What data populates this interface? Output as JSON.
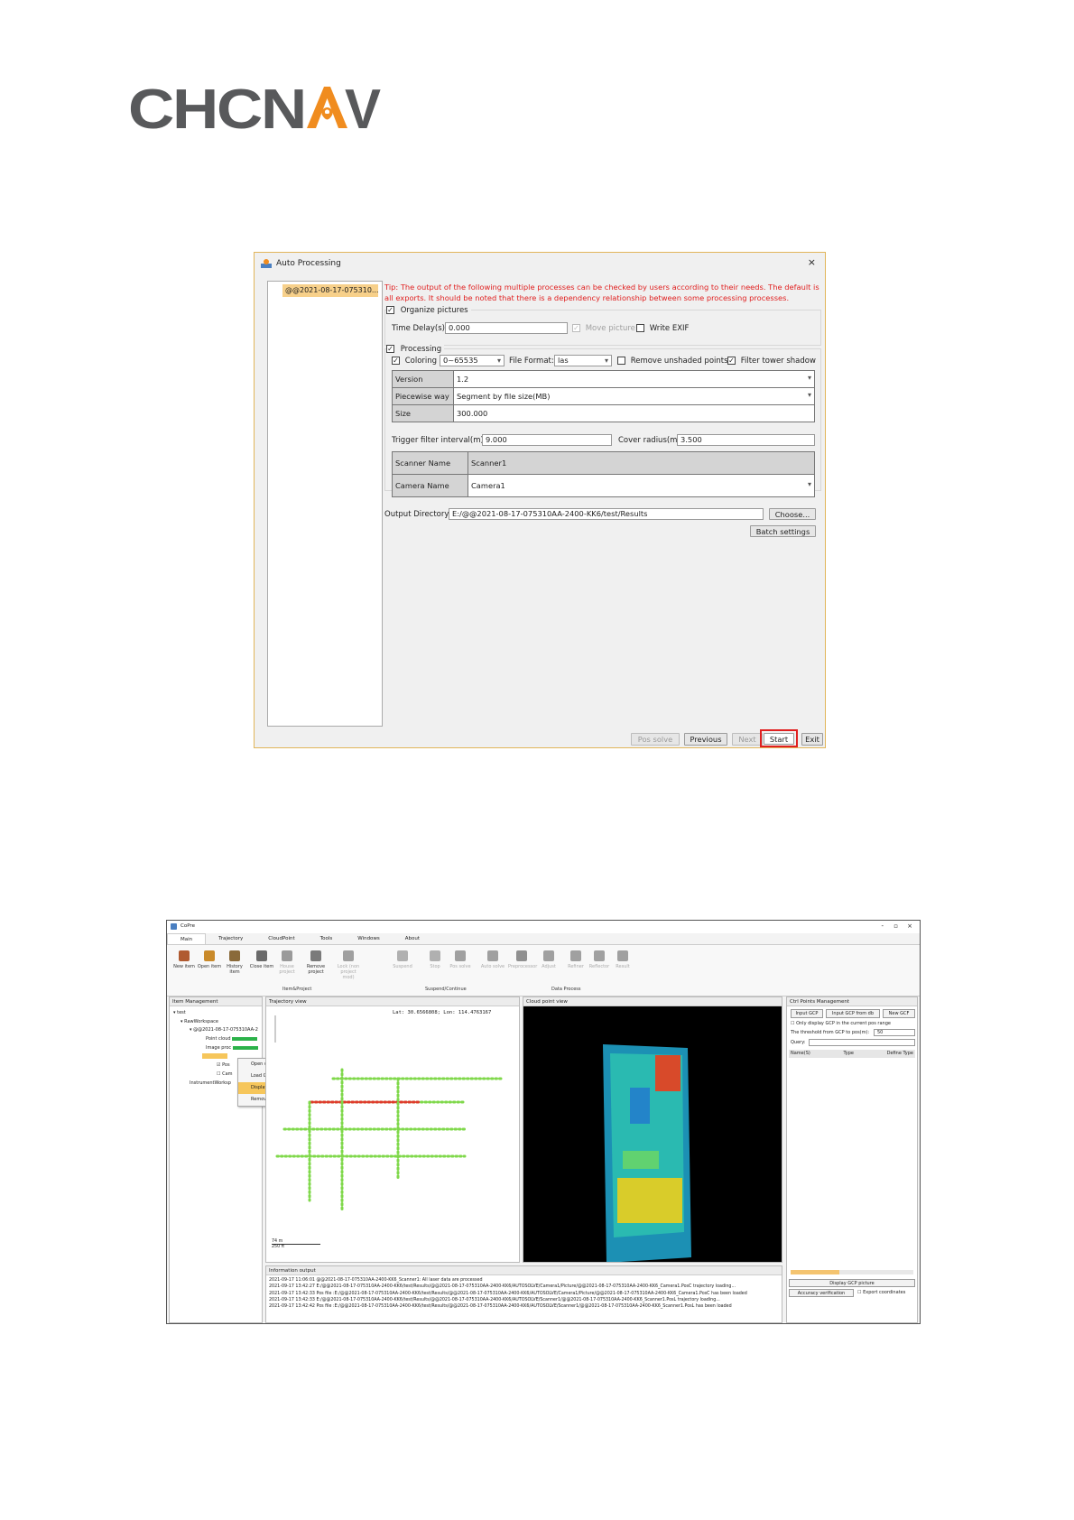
{
  "logo": {
    "text": "CHCNAV",
    "colors": {
      "text": "#58595b",
      "accent": "#f08c1f"
    }
  },
  "dialog": {
    "title": "Auto Processing",
    "close_glyph": "×",
    "project_item": "@@2021-08-17-075310...",
    "tip": "Tip: The output of the following multiple processes can be checked by users according to their needs. The default is all exports. It should be noted that there is a dependency relationship between some processing processes.",
    "organize": {
      "label": "Organize pictures",
      "time_delay_label": "Time Delay(s):",
      "time_delay_value": "0.000",
      "move_picture_label": "Move picture",
      "write_exif_label": "Write EXIF"
    },
    "processing": {
      "label": "Processing",
      "coloring_label": "Coloring",
      "coloring_value": "0~65535",
      "file_format_label": "File Format:",
      "file_format_value": "las",
      "remove_unshaded_label": "Remove unshaded points",
      "filter_tower_label": "Filter tower shadow",
      "rows": [
        {
          "label": "Version",
          "value": "1.2"
        },
        {
          "label": "Piecewise way",
          "value": "Segment by file size(MB)"
        },
        {
          "label": "Size",
          "value": "300.000"
        }
      ],
      "trigger_label": "Trigger filter interval(m):",
      "trigger_value": "9.000",
      "cover_label": "Cover radius(m):",
      "cover_value": "3.500",
      "scanner_label": "Scanner Name",
      "scanner_value": "Scanner1",
      "camera_label": "Camera Name",
      "camera_value": "Camera1"
    },
    "output": {
      "label": "Output Directory:",
      "value": "E:/@@2021-08-17-075310AA-2400-KK6/test/Results",
      "choose_label": "Choose...",
      "batch_label": "Batch settings"
    },
    "footer": {
      "pos_solve": "Pos solve",
      "previous": "Previous",
      "next": "Next",
      "start": "Start",
      "exit": "Exit"
    },
    "colors": {
      "tip": "#e02020",
      "start_highlight": "#e02020",
      "selected_item": "#f7d08a"
    }
  },
  "app": {
    "title": "CoPre",
    "win_controls": [
      "-",
      "▫",
      "×"
    ],
    "menus": [
      "Main",
      "Trajectory",
      "CloudPoint",
      "Tools",
      "Windows",
      "About"
    ],
    "ribbon": [
      {
        "label": "New item",
        "enabled": true
      },
      {
        "label": "Open item",
        "enabled": true
      },
      {
        "label": "History item",
        "enabled": true
      },
      {
        "label": "Close item",
        "enabled": true
      },
      {
        "label": "House project",
        "enabled": false
      },
      {
        "label": "Remove project",
        "enabled": true
      },
      {
        "label": "Lock (non project mod)",
        "enabled": false
      },
      {
        "label": "Suspend",
        "enabled": false
      },
      {
        "label": "Stop",
        "enabled": false
      },
      {
        "label": "Pos solve",
        "enabled": false
      },
      {
        "label": "Auto solve",
        "enabled": false
      },
      {
        "label": "Preprocessor",
        "enabled": false
      },
      {
        "label": "Adjust",
        "enabled": false
      },
      {
        "label": "Refiner",
        "enabled": false
      },
      {
        "label": "Reflector",
        "enabled": false
      },
      {
        "label": "Result",
        "enabled": false
      }
    ],
    "ribbon_sections": [
      "Item&Project",
      "Suspend/Continue",
      "Data Process"
    ],
    "item_panel": {
      "title": "Item Management",
      "tree": [
        "test",
        "RawWorkspace",
        "@@2021-08-17-075310AA-2",
        "Point cloud",
        "Image proc",
        "Pos",
        "Cam",
        "InstrumentWorksp"
      ]
    },
    "context_menu": [
      "Open directory",
      "Load Gnss",
      "Display pos trajectory",
      "Remove"
    ],
    "trajectory_panel": {
      "title": "Trajectory view",
      "coords": "Lat: 30.6566808; Lon: 114.4763167",
      "scale": [
        "74 m",
        "250 ft"
      ]
    },
    "cloud_panel": {
      "title": "Cloud point view"
    },
    "gcp_panel": {
      "title": "Ctrl Points Management",
      "buttons": [
        "Input GCP",
        "Input GCP from db",
        "New GCF"
      ],
      "only_display": "Only display GCP in the current pos range",
      "threshold_label": "The threshold from GCP to pos(m):",
      "threshold_value": "50",
      "query_label": "Query:",
      "columns": [
        "Name(S)",
        "Type",
        "Define Type"
      ],
      "display_btn": "Display GCP picture",
      "accuracy_btn": "Accuracy verification",
      "export_label": "Export coordinates"
    },
    "info_panel": {
      "title": "Information output",
      "lines": [
        "2021-09-17 11:06:01  @@2021-08-17-075310AA-2400-KK6_Scanner1: All laser data are processed",
        "2021-09-17 13:42:27  E:/@@2021-08-17-075310AA-2400-KK6/test/Results/@@2021-08-17-075310AA-2400-KK6/AUTOSOLVE/Camera1/Picture/@@2021-08-17-075310AA-2400-KK6_Camera1.PosC trajectory loading...",
        "2021-09-17 13:42:33  Pos file :E:/@@2021-08-17-075310AA-2400-KK6/test/Results/@@2021-08-17-075310AA-2400-KK6/AUTOSOLVE/Camera1/Picture/@@2021-08-17-075310AA-2400-KK6_Camera1.PosC has been loaded",
        "2021-09-17 13:42:33  E:/@@2021-08-17-075310AA-2400-KK6/test/Results/@@2021-08-17-075310AA-2400-KK6/AUTOSOLVE/Scanner1/@@2021-08-17-075310AA-2400-KK6_Scanner1.PosL trajectory loading...",
        "2021-09-17 13:42:42  Pos file :E:/@@2021-08-17-075310AA-2400-KK6/test/Results/@@2021-08-17-075310AA-2400-KK6/AUTOSOLVE/Scanner1/@@2021-08-17-075310AA-2400-KK6_Scanner1.PosL has been loaded"
      ]
    }
  }
}
